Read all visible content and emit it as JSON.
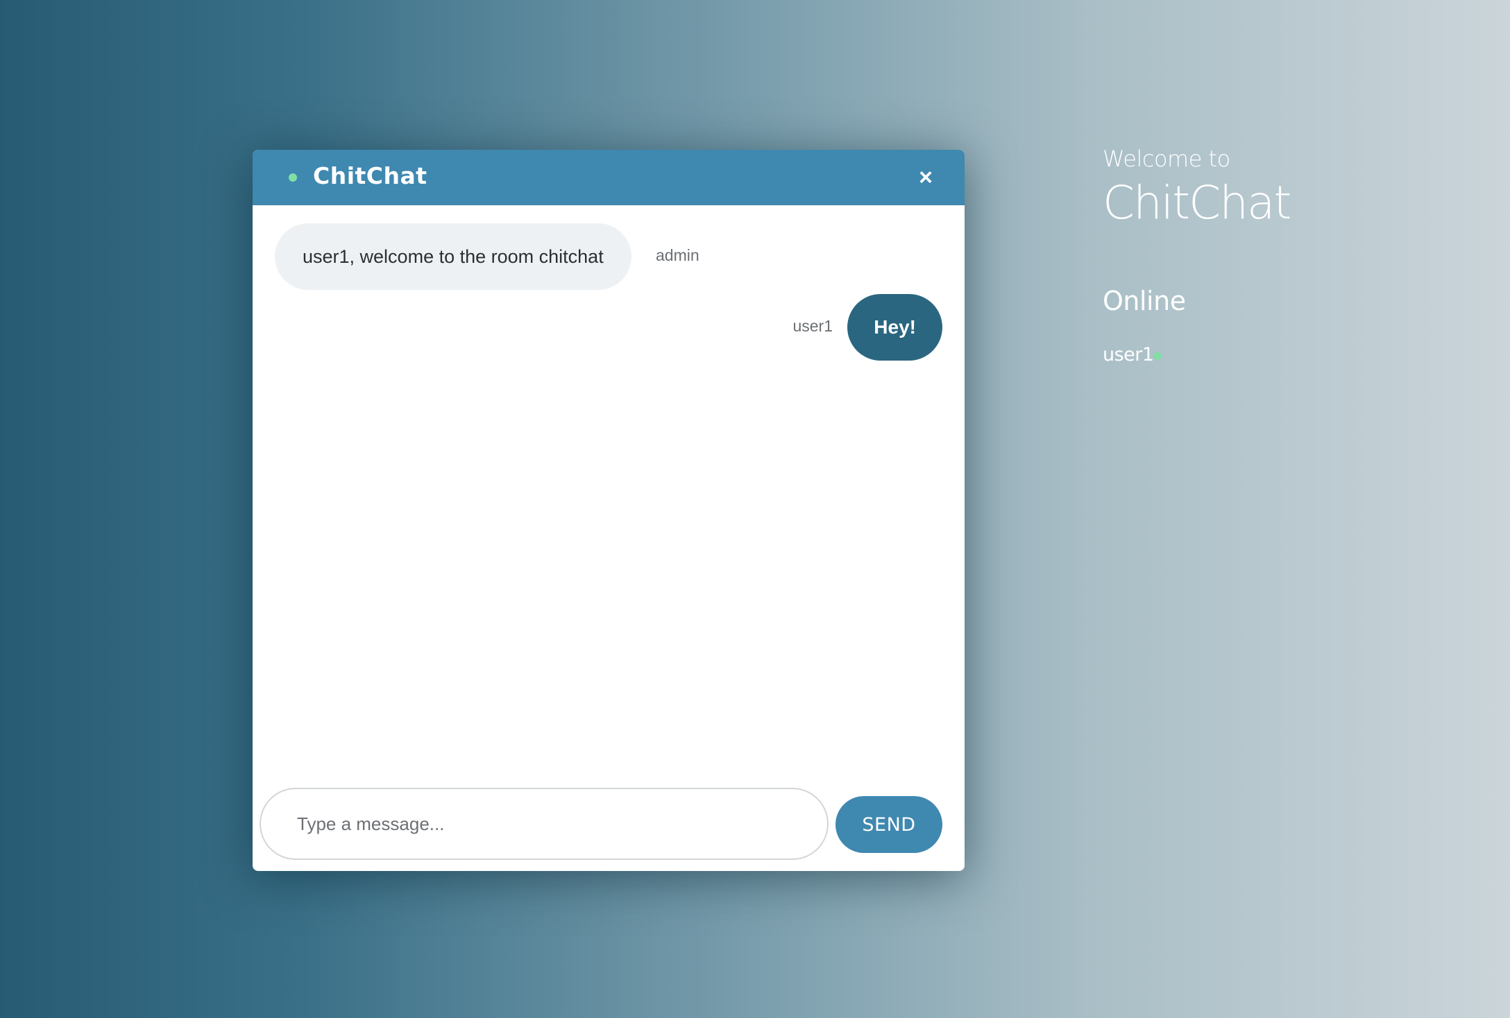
{
  "chat_window": {
    "title": "ChitChat",
    "close_label": "×",
    "status_dot_color": "#7fe0a3",
    "header_color": "#3f88b0"
  },
  "messages": [
    {
      "text": "user1, welcome to the room chitchat",
      "sender": "admin",
      "side": "left"
    },
    {
      "text": "Hey!",
      "sender": "user1",
      "side": "right"
    }
  ],
  "composer": {
    "placeholder": "Type a message...",
    "value": "",
    "send_label": "SEND"
  },
  "side_panel": {
    "welcome_small": "Welcome to",
    "welcome_big": "ChitChat",
    "online_heading": "Online",
    "online_users": [
      {
        "name": "user1",
        "status_color": "#7fe0a3"
      }
    ]
  }
}
